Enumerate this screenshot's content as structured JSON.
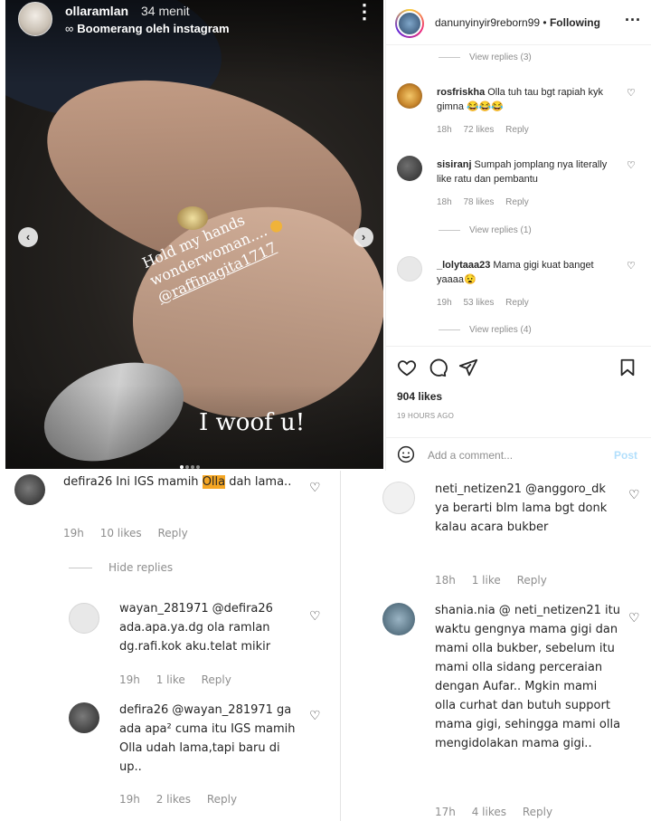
{
  "story": {
    "username": "ollaramlan",
    "time": "34 menit",
    "subtitle_icon": "infinity-icon",
    "subtitle": "Boomerang oleh instagram",
    "caption_line1": "Hold my hands",
    "caption_line2": "wonderwoman....",
    "caption_tag": "@raffinagita1717",
    "overlay_text": "I woof u!",
    "progress_dots": 4,
    "active_dot": 1
  },
  "post": {
    "username": "danunyinyir9reborn99",
    "follow_label": "Following",
    "view_replies_1": "View replies (3)",
    "comments": [
      {
        "user": "rosfriskha",
        "text": "Olla tuh tau bgt rapiah kyk gimna 😂😂😂",
        "time": "18h",
        "likes": "72 likes",
        "reply": "Reply"
      },
      {
        "user": "sisiranj",
        "text": "Sumpah jomplang nya literally like ratu dan pembantu",
        "time": "18h",
        "likes": "78 likes",
        "reply": "Reply"
      },
      {
        "user": "_lolytaaa23",
        "text": "Mama gigi kuat banget yaaaa😧",
        "time": "19h",
        "likes": "53 likes",
        "reply": "Reply"
      }
    ],
    "view_replies_2": "View replies (1)",
    "view_replies_3": "View replies (4)",
    "likes": "904 likes",
    "ago": "19 HOURS AGO",
    "add_comment_placeholder": "Add a comment...",
    "post_label": "Post"
  },
  "left_thread": {
    "main": {
      "user": "defira26",
      "text_before": "Ini IGS mamih ",
      "highlight": "Olla",
      "text_after": " dah lama..",
      "time": "19h",
      "likes": "10 likes",
      "reply": "Reply"
    },
    "hide_replies": "Hide replies",
    "replies": [
      {
        "user": "wayan_281971",
        "text": "@defira26 ada.apa.ya.dg ola ramlan dg.rafi.kok aku.telat mikir",
        "time": "19h",
        "likes": "1 like",
        "reply": "Reply"
      },
      {
        "user": "defira26",
        "text": "@wayan_281971 ga ada apa² cuma itu IGS mamih Olla udah lama,tapi baru di up..",
        "time": "19h",
        "likes": "2 likes",
        "reply": "Reply"
      }
    ]
  },
  "right_thread": {
    "replies": [
      {
        "user": "neti_netizen21",
        "text": "@anggoro_dk ya berarti blm lama bgt donk kalau acara bukber",
        "time": "18h",
        "likes": "1 like",
        "reply": "Reply"
      },
      {
        "user": "shania.nia",
        "text": "@ neti_netizen21 itu waktu gengnya mama gigi dan mami olla bukber, sebelum itu mami olla sidang perceraian dengan Aufar.. Mgkin mami olla curhat dan butuh support mama gigi, sehingga mami olla mengidolakan mama gigi..",
        "time": "17h",
        "likes": "4 likes",
        "reply": "Reply"
      }
    ]
  }
}
